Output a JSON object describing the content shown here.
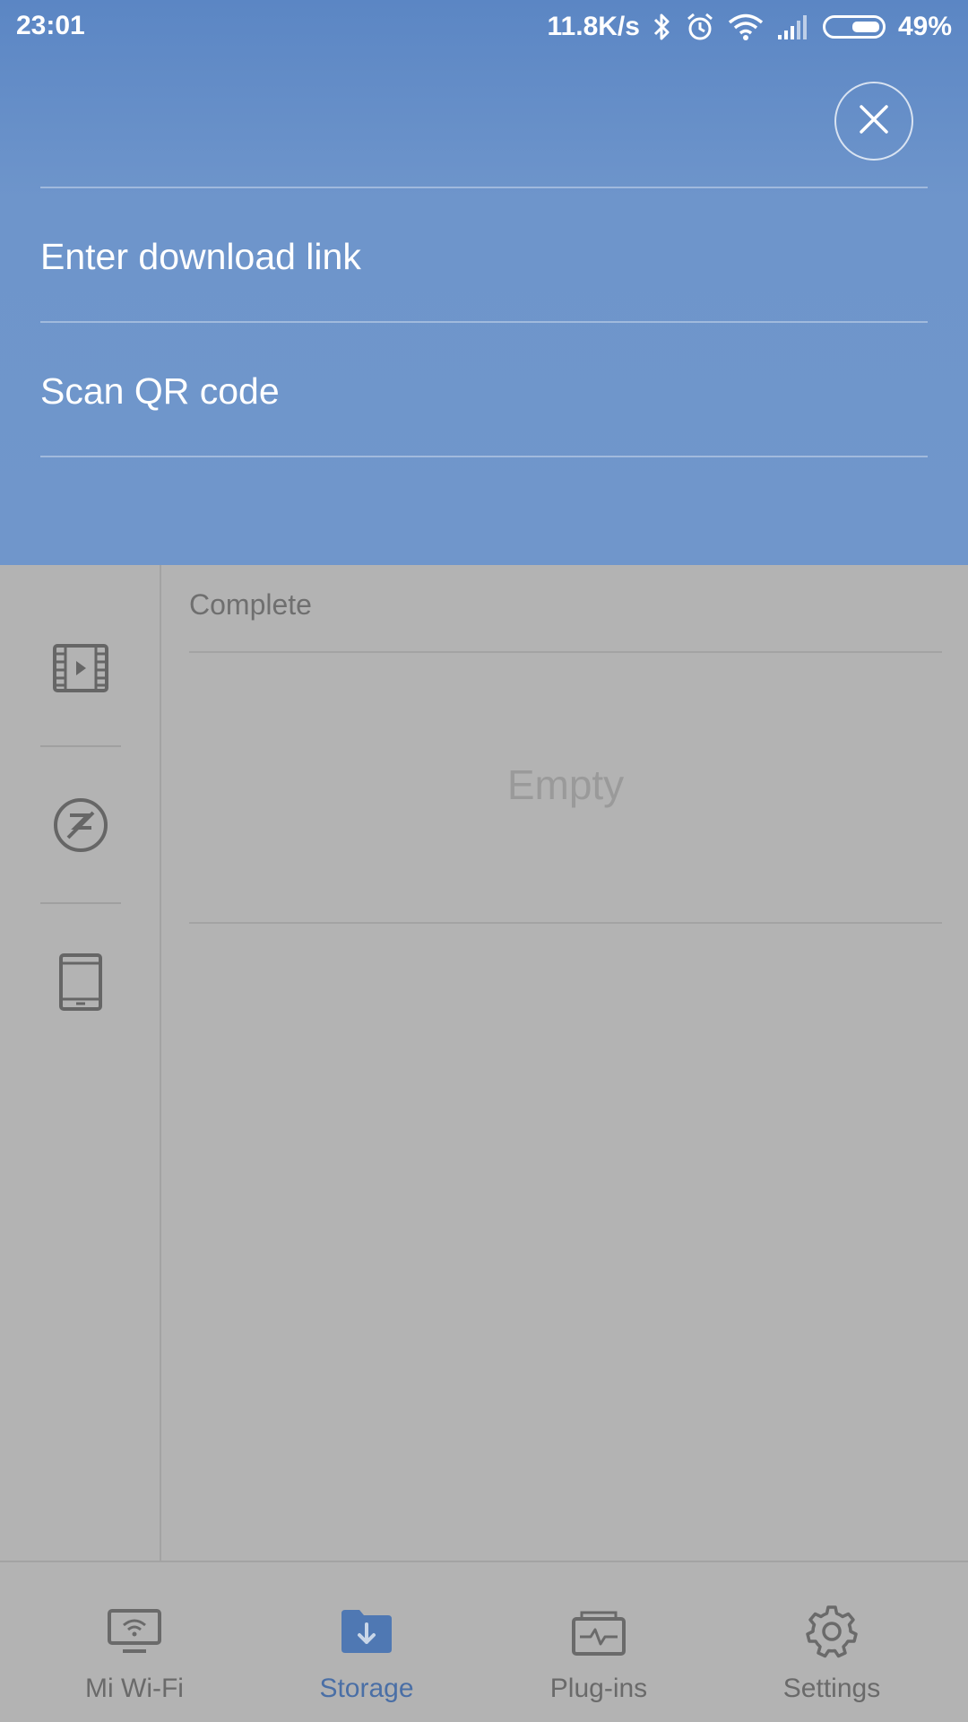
{
  "status_bar": {
    "time": "23:01",
    "network_speed": "11.8K/s",
    "battery_percent": "49%",
    "battery_level": 0.49,
    "icons": [
      "bluetooth-icon",
      "alarm-icon",
      "wifi-icon",
      "signal-icon",
      "battery-icon"
    ]
  },
  "overlay_menu": {
    "close_icon": "close-icon",
    "items": [
      {
        "label": "Enter download link"
      },
      {
        "label": "Scan QR code"
      }
    ]
  },
  "left_rail": {
    "icons": [
      "video-icon",
      "no-music-icon",
      "tablet-icon"
    ]
  },
  "content": {
    "section_header": "Complete",
    "empty_text": "Empty"
  },
  "bottom_nav": {
    "active": "Storage",
    "items": [
      {
        "label": "Mi Wi-Fi",
        "icon": "router-wifi-icon"
      },
      {
        "label": "Storage",
        "icon": "download-folder-icon"
      },
      {
        "label": "Plug-ins",
        "icon": "plugin-box-icon"
      },
      {
        "label": "Settings",
        "icon": "gear-icon"
      }
    ]
  },
  "colors": {
    "panel_blue": "#6e95cb",
    "dim_gray": "#b3b3b3",
    "active_tab": "#4a6fa6"
  }
}
